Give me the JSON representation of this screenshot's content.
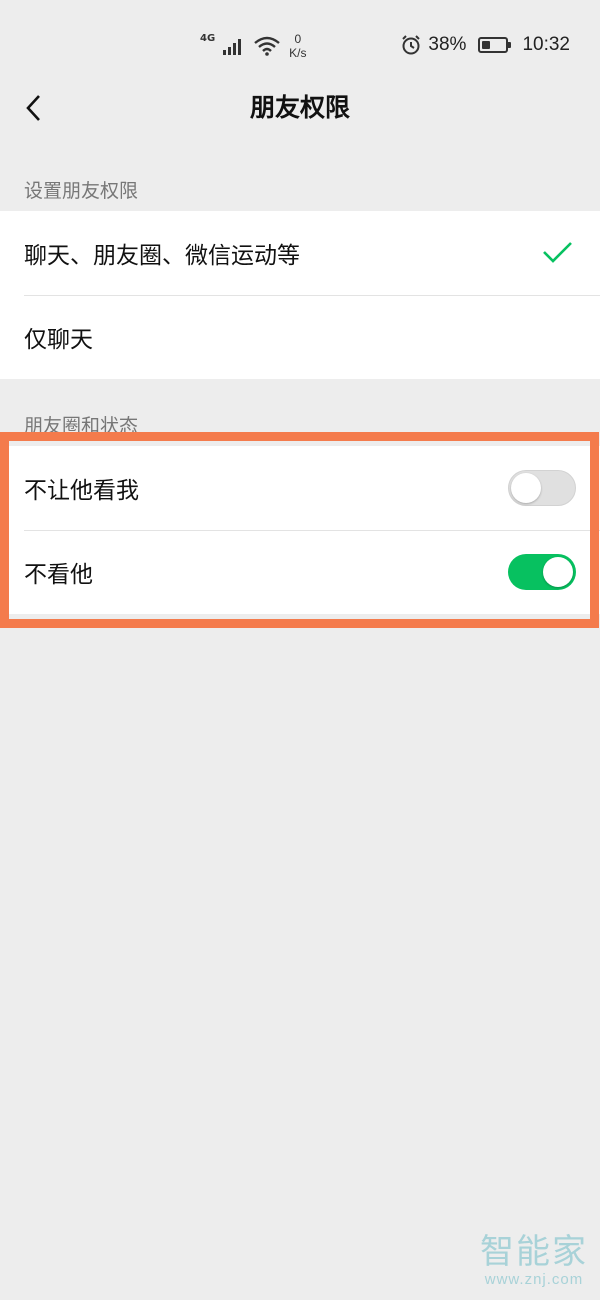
{
  "status_bar": {
    "network": "4G",
    "speed_value": "0",
    "speed_unit": "K/s",
    "battery_percent": "38%",
    "battery_level": 0.38,
    "time": "10:32"
  },
  "header": {
    "title": "朋友权限"
  },
  "permissions": {
    "section_label": "设置朋友权限",
    "options": [
      {
        "label": "聊天、朋友圈、微信运动等",
        "selected": true
      },
      {
        "label": "仅聊天",
        "selected": false
      }
    ]
  },
  "moments": {
    "section_label": "朋友圈和状态",
    "toggles": [
      {
        "label": "不让他看我",
        "on": false
      },
      {
        "label": "不看他",
        "on": true
      }
    ]
  },
  "colors": {
    "accent_green": "#07c160",
    "highlight": "#f47b4c",
    "background": "#ededed"
  },
  "watermark": {
    "logo": "智能家",
    "url": "www.znj.com"
  }
}
